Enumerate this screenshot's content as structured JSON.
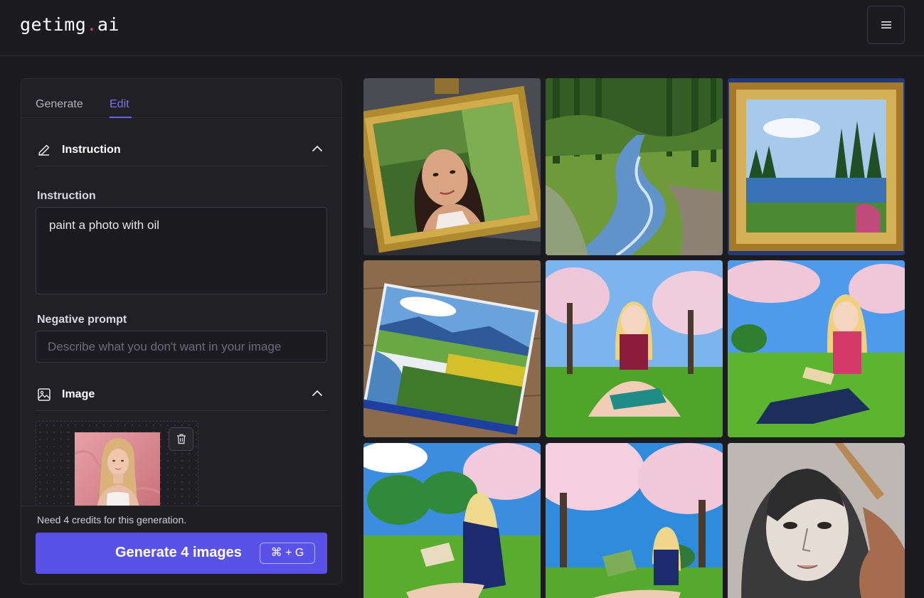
{
  "app": {
    "logo_left": "getimg",
    "logo_dot": ".",
    "logo_right": "ai",
    "menu_icon": "hamburger-icon"
  },
  "tabs": [
    {
      "label": "Generate",
      "active": false
    },
    {
      "label": "Edit",
      "active": true
    }
  ],
  "instruction_section": {
    "title": "Instruction",
    "icon": "pencil-icon",
    "field_label": "Instruction",
    "value": "paint a photo with oil"
  },
  "negative_prompt": {
    "label": "Negative prompt",
    "placeholder": "Describe what you don't want in your image"
  },
  "image_section": {
    "title": "Image",
    "icon": "image-icon"
  },
  "footer": {
    "credits_text": "Need 4 credits for this generation.",
    "generate_label": "Generate 4 images",
    "shortcut": "⌘ + G"
  },
  "colors": {
    "accent": "#5a52e8",
    "active_tab": "#7a73f0",
    "background": "#1c1c20"
  },
  "gallery": [
    {
      "subject": "woman portrait in gold frame"
    },
    {
      "subject": "forest river oil painting"
    },
    {
      "subject": "lake landscape in gold frame"
    },
    {
      "subject": "landscape canvas on wooden easel"
    },
    {
      "subject": "anime girl reading under cherry blossoms"
    },
    {
      "subject": "anime girl reading on grass"
    },
    {
      "subject": "anime girl reading in park"
    },
    {
      "subject": "anime girl reading under cherry tree"
    },
    {
      "subject": "pencil sketch of woman"
    }
  ]
}
